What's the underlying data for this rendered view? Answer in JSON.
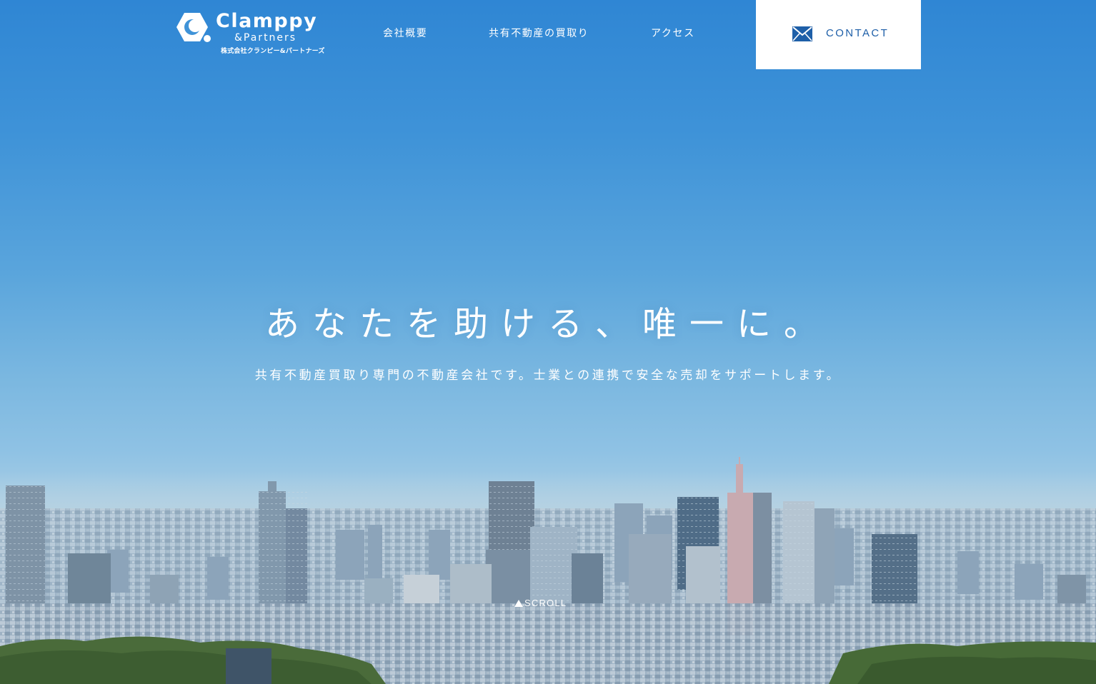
{
  "logo": {
    "name": "Clamppy",
    "sub": "&Partners",
    "jp": "株式会社クランピー&パートナーズ"
  },
  "nav": {
    "items": [
      {
        "label": "会社概要"
      },
      {
        "label": "共有不動産の買取り"
      },
      {
        "label": "アクセス"
      }
    ],
    "contact": {
      "label": "CONTACT",
      "icon": "mail-icon"
    }
  },
  "hero": {
    "headline": "あなたを助ける、唯一に。",
    "subline": "共有不動産買取り専門の不動産会社です。士業との連携で安全な売却をサポートします。",
    "scroll_label": "SCROLL",
    "scroll_icon": "triangle-up-icon"
  },
  "colors": {
    "sky_top": "#2f86d4",
    "sky_bottom": "#b6d3e4",
    "contact_text": "#1e5fa8",
    "text_white": "#ffffff"
  }
}
